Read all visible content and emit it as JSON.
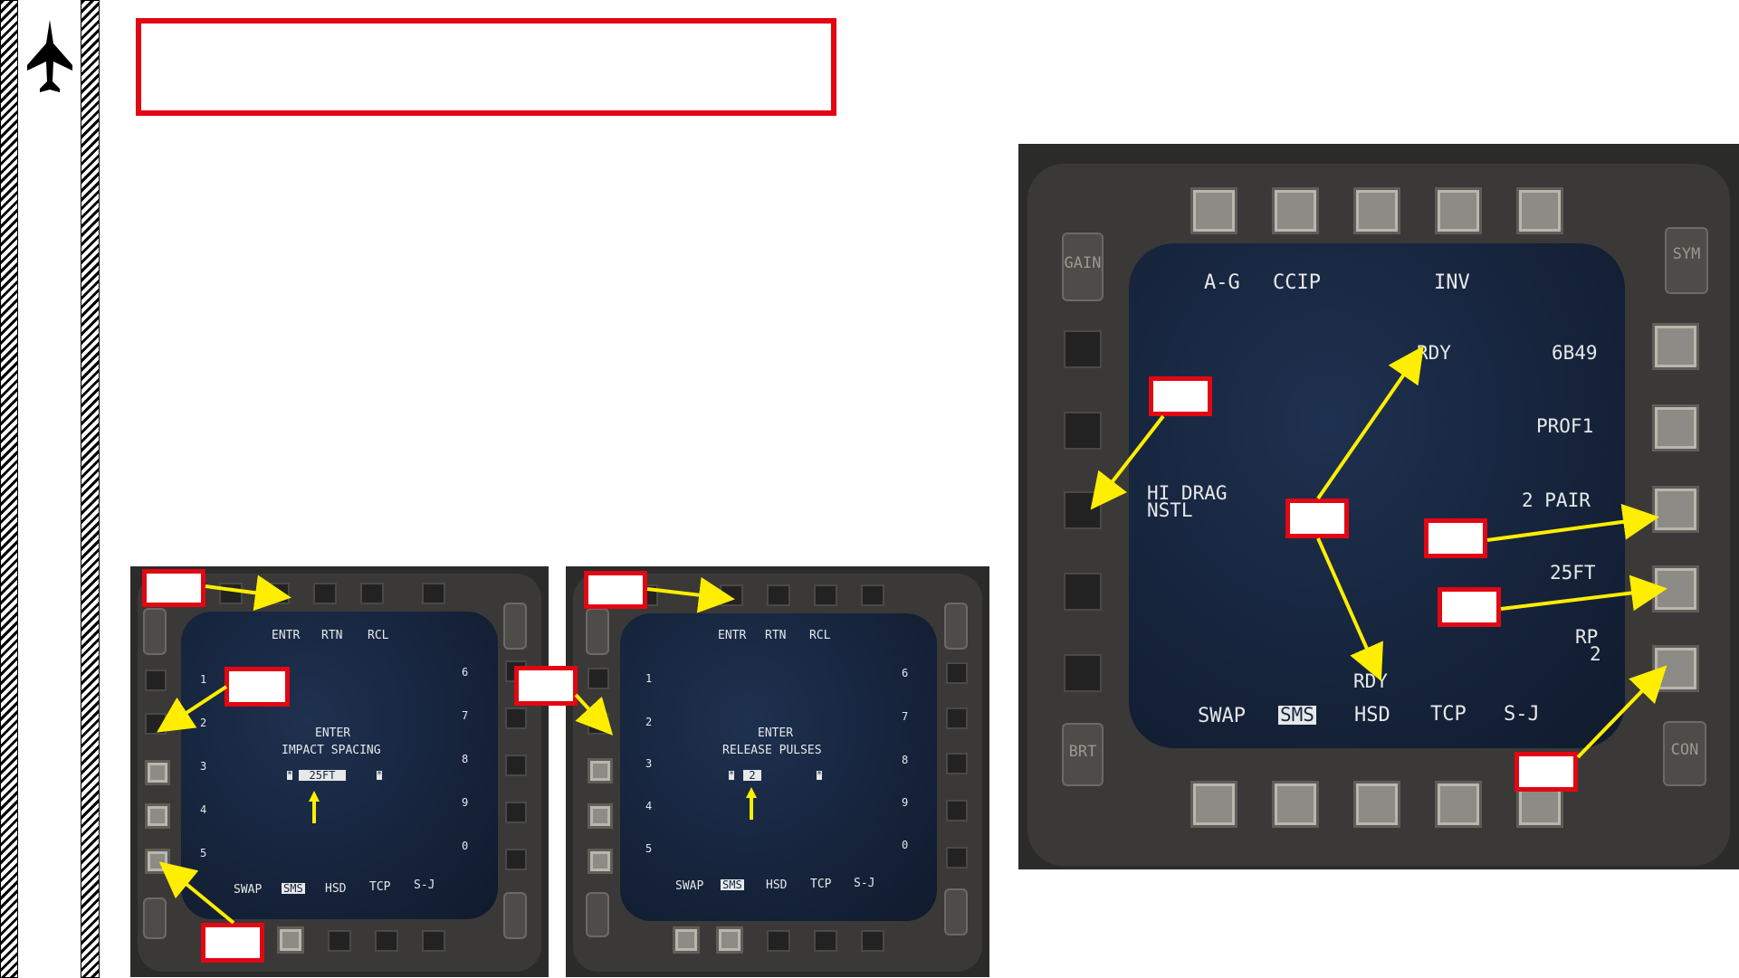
{
  "colors": {
    "accent_red": "#e30613",
    "arrow_yellow": "#ffee00",
    "mfd_text": "#e6e8ea"
  },
  "sidebar": {
    "icon": "jet-icon"
  },
  "mfd_left": {
    "top_labels": [
      "ENTR",
      "RTN",
      "RCL"
    ],
    "left_numbers": [
      "1",
      "2",
      "3",
      "4",
      "5"
    ],
    "right_numbers": [
      "6",
      "7",
      "8",
      "9",
      "0"
    ],
    "prompt_line1": "ENTER",
    "prompt_line2": "IMPACT SPACING",
    "entry_value": "25FT",
    "bottom_labels": [
      "SWAP",
      "SMS",
      "HSD",
      "TCP",
      "S-J"
    ],
    "selected_bottom": "SMS"
  },
  "mfd_middle": {
    "top_labels": [
      "ENTR",
      "RTN",
      "RCL"
    ],
    "left_numbers": [
      "1",
      "2",
      "3",
      "4",
      "5"
    ],
    "right_numbers": [
      "6",
      "7",
      "8",
      "9",
      "0"
    ],
    "prompt_line1": "ENTER",
    "prompt_line2": "RELEASE PULSES",
    "entry_value": "2",
    "bottom_labels": [
      "SWAP",
      "SMS",
      "HSD",
      "TCP",
      "S-J"
    ],
    "selected_bottom": "SMS"
  },
  "mfd_right": {
    "top_left": "A-G",
    "top_mode": "CCIP",
    "top_inv": "INV",
    "rdy_top": "RDY",
    "rdy_bottom": "RDY",
    "weapon_code": "6B49",
    "profile": "PROF1",
    "release_mode": "2 PAIR",
    "spacing": "25FT",
    "rp_label": "RP",
    "rp_value": "2",
    "fuze_line1": "HI DRAG",
    "fuze_line2": "NSTL",
    "bottom_labels": [
      "SWAP",
      "SMS",
      "HSD",
      "TCP",
      "S-J"
    ],
    "selected_bottom": "SMS",
    "gain_label": "GAIN",
    "sym_label": "SYM",
    "brt_label": "BRT",
    "con_label": "CON"
  }
}
